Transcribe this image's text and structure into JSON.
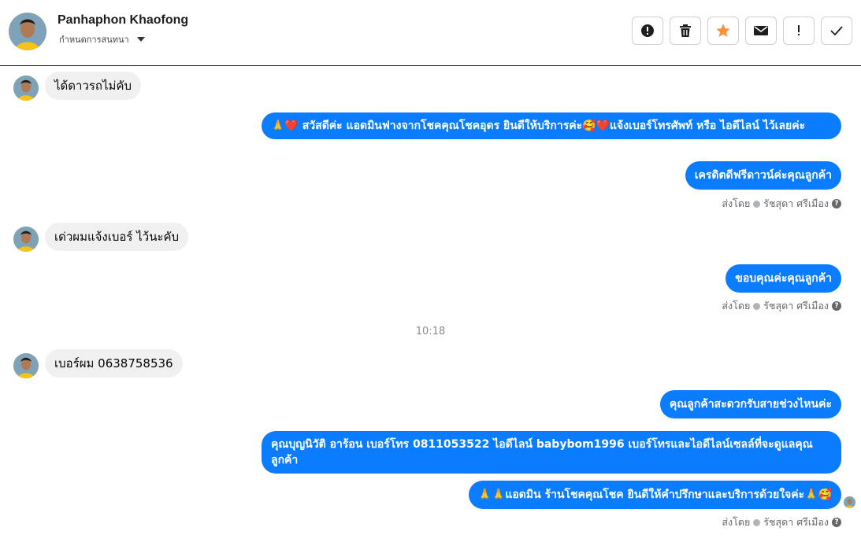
{
  "header": {
    "name": "Panhaphon Khaofong",
    "subtitle": "กำหนดการสนทนา",
    "actions": [
      {
        "icon": "alert-circle-icon",
        "label": "report"
      },
      {
        "icon": "trash-icon",
        "label": "delete"
      },
      {
        "icon": "star-icon",
        "label": "star"
      },
      {
        "icon": "envelope-icon",
        "label": "mark-unread"
      },
      {
        "icon": "exclamation-icon",
        "label": "spam"
      },
      {
        "icon": "checkmark-icon",
        "label": "done"
      }
    ],
    "star_color": "#f7923a"
  },
  "messages": {
    "m1": "ได้ดาวรถไม่คับ",
    "m2": "🙏❤️ สวัสดีค่ะ แอดมินฟางจากโชคคุณโชคอุดร ยินดีให้บริการค่ะ🥰❤️แจ้งเบอร์โทรศัพท์ หรือ ไอดีไลน์  ไว้เลยค่ะ",
    "m3": "เครดิตดีฟรีดาวน์ค่ะคุณลูกค้า",
    "m4": "เด่วผมแจ้งเบอร์ ไว้นะคับ",
    "m5": "ขอบคุณค่ะคุณลูกค้า",
    "time": "10:18",
    "m6": "เบอร์ผม 0638758536",
    "m7": "คุณลูกค้าสะดวกรับสายช่วงไหนค่ะ",
    "m8": "คุณบุญนิวัติ  อาร้อน        เบอร์โทร 0811053522  ไอดีไลน์ babybom1996   เบอร์โทรและไอดีไลน์เซลล์ที่จะดูแลคุณลูกค้า",
    "m9": "🙏🙏แอดมิน ร้านโชคคุณโชค ยินดีให้คำปรึกษาและบริการด้วยใจค่ะ🙏🥰"
  },
  "sent_by": {
    "prefix": "ส่งโดย",
    "agent": "รัชสุดา ศรีเมือง",
    "help": "?"
  },
  "colors": {
    "outgoing_bubble": "#0a7cff",
    "incoming_bubble": "#f0f0f0"
  }
}
